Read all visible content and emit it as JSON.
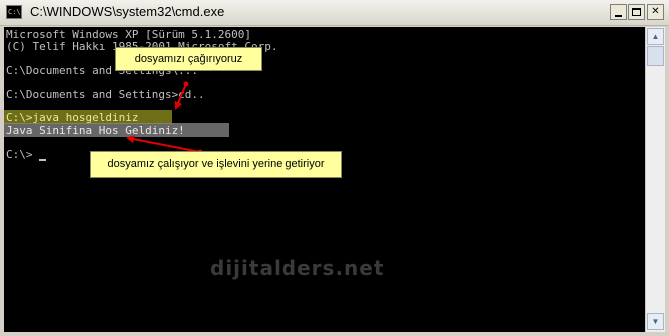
{
  "window": {
    "title": "C:\\WINDOWS\\system32\\cmd.exe",
    "icon": "console-icon",
    "controls": [
      "minimize-icon",
      "maximize-icon",
      "close-icon"
    ]
  },
  "console": {
    "lines": [
      "Microsoft Windows XP [Sürüm 5.1.2600]",
      "(C) Telif Hakkı 1985-2001 Microsoft Corp.",
      "",
      "C:\\Documents and Settings\\...",
      "",
      "C:\\Documents and Settings>cd..",
      "",
      "C:\\>java hosgeldiniz",
      "Java Sinifina Hos Geldiniz!",
      "",
      "C:\\>"
    ]
  },
  "annotations": {
    "callout_1": "dosyamızı çağırıyoruz",
    "callout_2": "dosyamız çalışıyor ve işlevini yerine getiriyor",
    "arrow_color": "#e00000",
    "callout_color": "#ffff9e"
  },
  "watermark": "dijitalders.net",
  "colors": {
    "console_bg": "#000000",
    "console_text": "#c0c0c0",
    "highlight_command": "#c8c829",
    "highlight_output": "#8a8a8a"
  }
}
